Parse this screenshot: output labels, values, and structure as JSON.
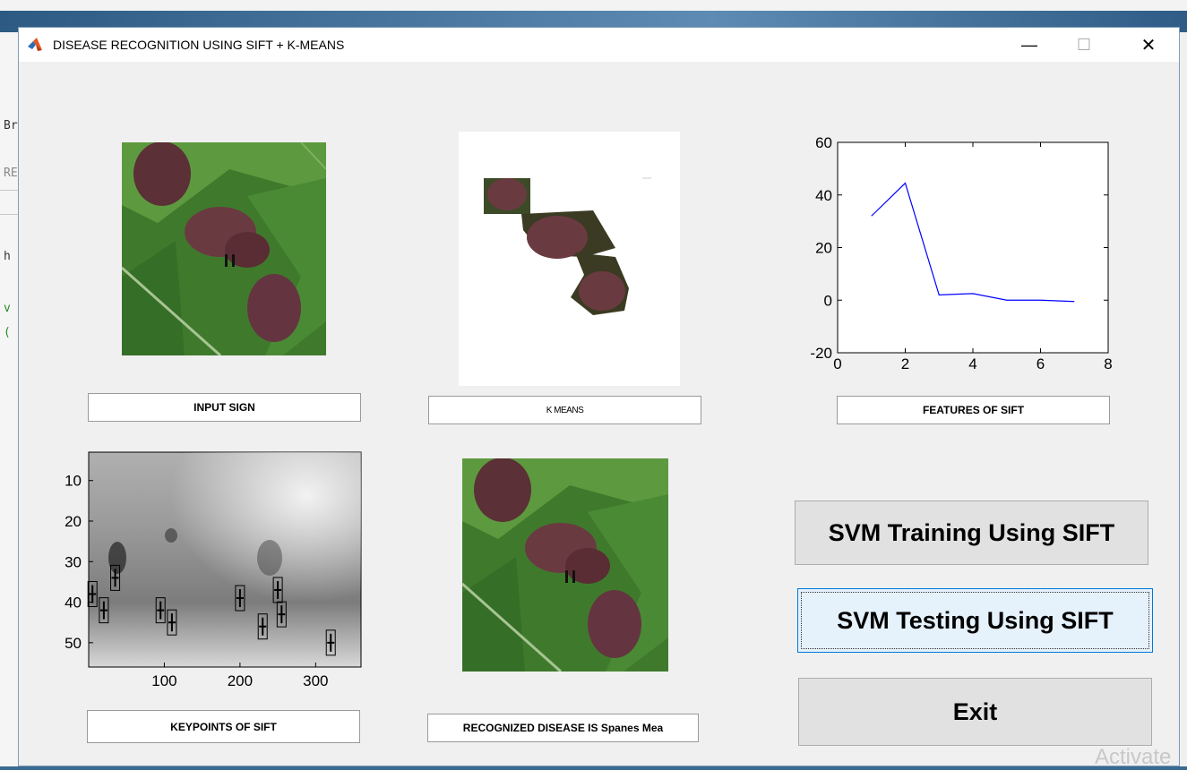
{
  "window": {
    "title": "DISEASE RECOGNITION USING SIFT + K-MEANS",
    "minimize_glyph": "—",
    "maximize_glyph": "☐",
    "close_glyph": "✕"
  },
  "background": {
    "left_glyphs": [
      "Br",
      "RE",
      "h",
      "v",
      "("
    ],
    "watermark": "Activate"
  },
  "panels": {
    "input_label": "INPUT SIGN",
    "kmeans_label": "K MEANS",
    "features_label": "FEATURES OF SIFT",
    "keypoints_label": "KEYPOINTS OF SIFT",
    "recognized_label": "RECOGNIZED DISEASE IS Spanes Mea"
  },
  "buttons": {
    "train": "SVM Training Using SIFT",
    "test": "SVM Testing Using SIFT",
    "exit": "Exit"
  },
  "colors": {
    "line": "#0000ff",
    "window_bg": "#f0f0f0",
    "focus_border": "#0078d7"
  },
  "chart_data": [
    {
      "type": "line",
      "title": "",
      "xlabel": "",
      "ylabel": "",
      "x": [
        1,
        2,
        3,
        4,
        5,
        6,
        7
      ],
      "series": [
        {
          "values": [
            32,
            44.5,
            2,
            2.5,
            0,
            0,
            -0.5
          ]
        }
      ],
      "xlim": [
        0,
        8
      ],
      "ylim": [
        -20,
        60
      ],
      "xticks": [
        "0",
        "2",
        "4",
        "6",
        "8"
      ],
      "yticks": [
        "-20",
        "0",
        "20",
        "40",
        "60"
      ],
      "grid": false
    },
    {
      "type": "scatter",
      "title": "",
      "xlabel": "",
      "ylabel": "",
      "xlim": [
        0,
        360
      ],
      "ylim": [
        56,
        3
      ],
      "xticks": [
        "100",
        "200",
        "300"
      ],
      "yticks": [
        "10",
        "20",
        "30",
        "40",
        "50"
      ],
      "x": [
        5,
        20,
        35,
        95,
        110,
        200,
        230,
        250,
        255,
        320
      ],
      "y": [
        38,
        42,
        34,
        42,
        45,
        39,
        46,
        37,
        43,
        50
      ]
    }
  ]
}
